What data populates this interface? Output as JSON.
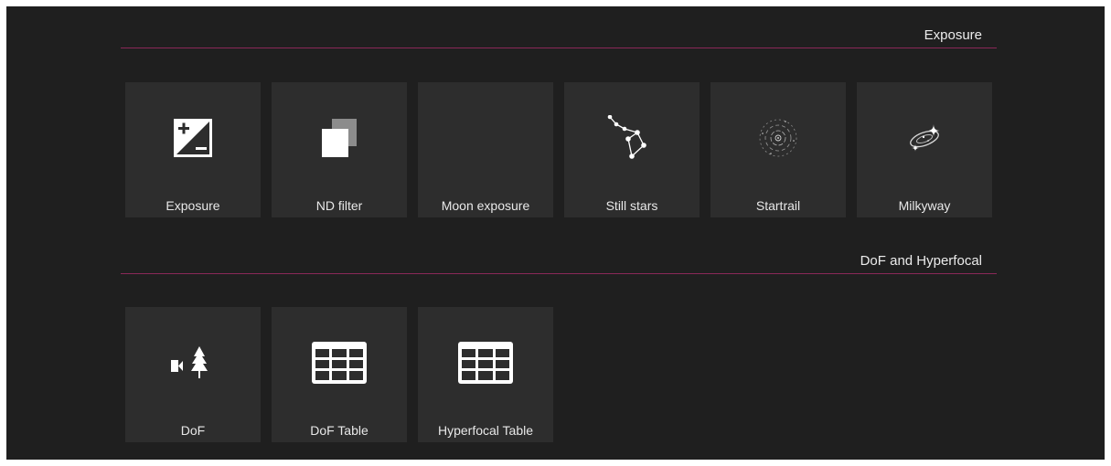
{
  "sections": [
    {
      "title": "Exposure",
      "tiles": [
        {
          "label": "Exposure",
          "icon": "exposure-compensation-icon"
        },
        {
          "label": "ND filter",
          "icon": "nd-filter-icon"
        },
        {
          "label": "Moon exposure",
          "icon": "moon-icon"
        },
        {
          "label": "Still stars",
          "icon": "constellation-icon"
        },
        {
          "label": "Startrail",
          "icon": "startrail-icon"
        },
        {
          "label": "Milkyway",
          "icon": "galaxy-icon"
        }
      ]
    },
    {
      "title": "DoF and Hyperfocal",
      "tiles": [
        {
          "label": "DoF",
          "icon": "camera-tree-icon"
        },
        {
          "label": "DoF Table",
          "icon": "table-icon"
        },
        {
          "label": "Hyperfocal Table",
          "icon": "table-icon"
        }
      ]
    }
  ],
  "colors": {
    "background": "#1f1f1f",
    "tile": "#2d2d2d",
    "accent_line": "#8a2858",
    "text": "#e8e8e8"
  }
}
